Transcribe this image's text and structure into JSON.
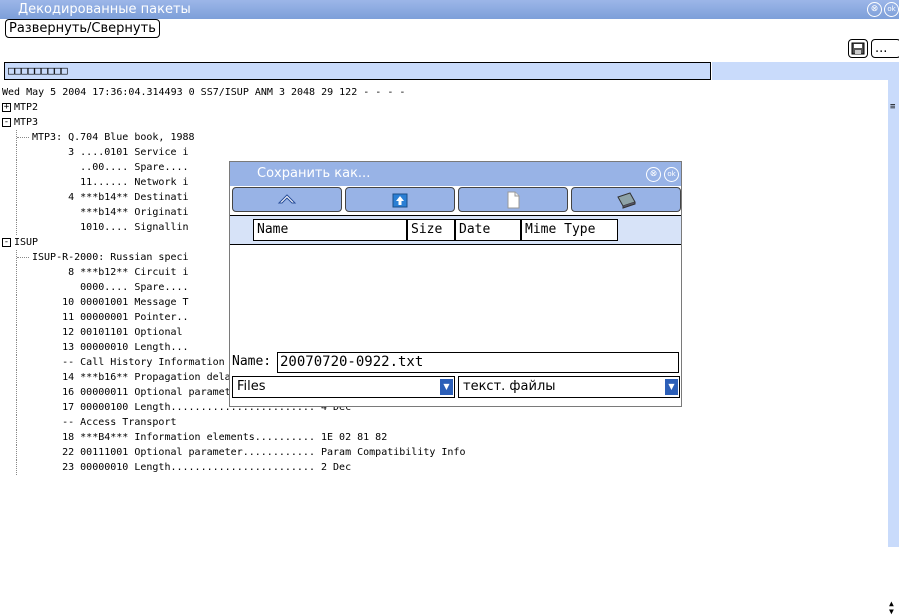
{
  "window": {
    "title": "Декодированные пакеты",
    "icon_labels": [
      "⊗",
      "ok"
    ]
  },
  "toolbar": {
    "expand_label": "Развернуть/Свернуть",
    "save_icon": "save-icon",
    "more_label": "..."
  },
  "packet_header": "□□□□□□□□□",
  "tree_rows": [
    {
      "text": "Wed May 5 2004 17:36:04.314493 0 SS7/ISUP ANM 3 2048 29 122 - - - -",
      "indent": 0
    },
    {
      "box": "+",
      "text": "MTP2",
      "indent": 0
    },
    {
      "box": "-",
      "text": "MTP3",
      "indent": 0
    },
    {
      "text": "MTP3: Q.704 Blue book, 1988",
      "indent": 1
    },
    {
      "text": "      3 ....0101 Service i",
      "indent": 2
    },
    {
      "text": "        ..00.... Spare....",
      "indent": 2
    },
    {
      "text": "        11...... Network i",
      "indent": 2
    },
    {
      "text": "      4 ***b14** Destinati",
      "indent": 2
    },
    {
      "text": "        ***b14** Originati",
      "indent": 2
    },
    {
      "text": "        1010.... Signallin",
      "indent": 2
    },
    {
      "box": "-",
      "text": "ISUP",
      "indent": 0
    },
    {
      "text": "ISUP-R-2000: Russian speci",
      "indent": 1
    },
    {
      "text": "      8 ***b12** Circuit i",
      "indent": 2
    },
    {
      "text": "        0000.... Spare....",
      "indent": 2
    },
    {
      "text": "     10 00001001 Message T",
      "indent": 2
    },
    {
      "text": "     11 00000001 Pointer..",
      "indent": 2
    },
    {
      "text": "     12 00101101 Optional ",
      "indent": 2
    },
    {
      "text": "     13 00000010 Length...",
      "indent": 2
    },
    {
      "text": "     -- Call History Information",
      "indent": 2
    },
    {
      "text": "     14 ***b16** Propagation delay value....... 0 Dec",
      "indent": 2
    },
    {
      "text": "     16 00000011 Optional parameter............ Access Transport",
      "indent": 2
    },
    {
      "text": "     17 00000100 Length........................ 4 Dec",
      "indent": 2
    },
    {
      "text": "     -- Access Transport",
      "indent": 2
    },
    {
      "text": "     18 ***B4*** Information elements.......... 1E 02 81 82",
      "indent": 2
    },
    {
      "text": "     22 00111001 Optional parameter............ Param Compatibility Info",
      "indent": 2
    },
    {
      "text": "     23 00000010 Length........................ 2 Dec",
      "indent": 2
    }
  ],
  "dialog": {
    "title": "Сохранить как...",
    "icon_labels": [
      "⊗",
      "ok"
    ],
    "nav_icons": [
      "home-icon",
      "up-folder-icon",
      "new-file-icon",
      "drive-icon"
    ],
    "columns": [
      "Name",
      "Size",
      "Date",
      "Mime Type"
    ],
    "name_label": "Name:",
    "name_value": "20070720-0922.txt",
    "location": "Files",
    "filter": "текст. файлы"
  }
}
